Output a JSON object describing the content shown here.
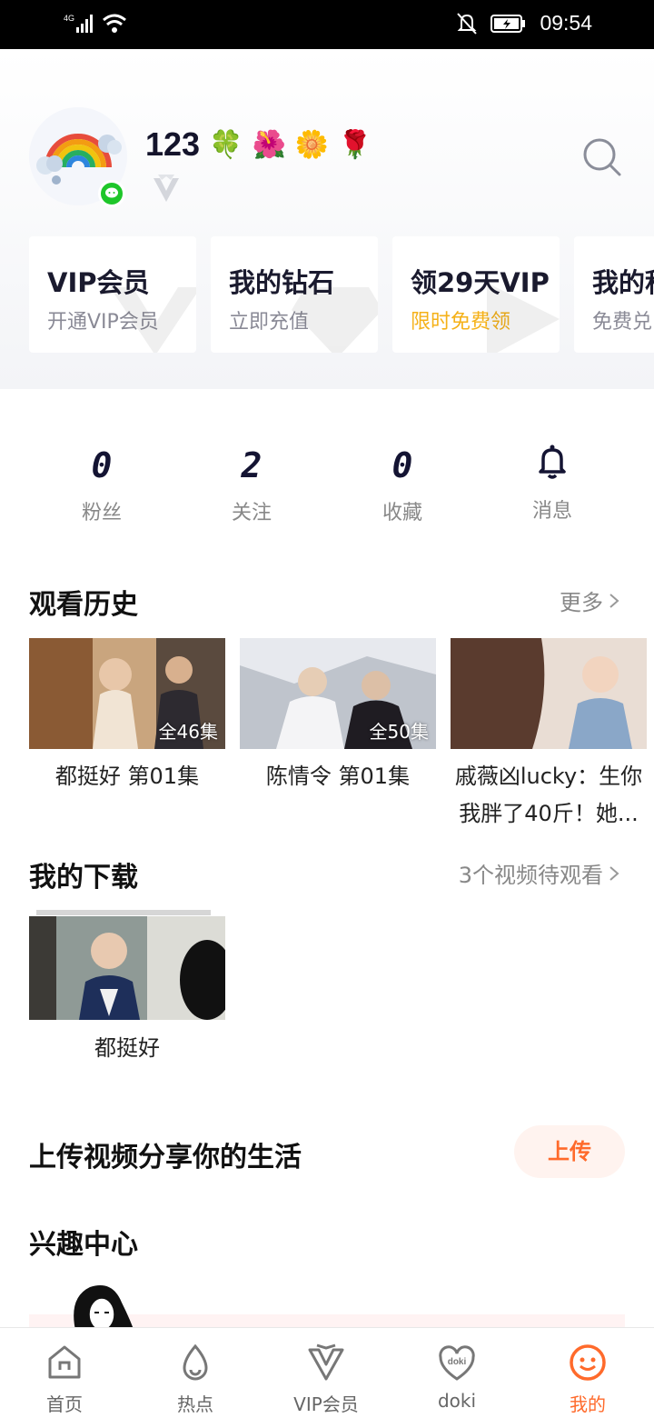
{
  "status_bar": {
    "network": "4G",
    "time": "09:54"
  },
  "profile": {
    "name": "123",
    "name_emojis": [
      "🍀",
      "🌺",
      "🌼",
      "🌹"
    ]
  },
  "benefit_cards": [
    {
      "title": "VIP会员",
      "subtitle": "开通VIP会员",
      "highlight": false
    },
    {
      "title": "我的钻石",
      "subtitle": "立即充值",
      "highlight": false
    },
    {
      "title": "领29天VIP",
      "subtitle": "限时免费领",
      "highlight": true
    },
    {
      "title": "我的积",
      "subtitle": "免费兑",
      "highlight": false
    }
  ],
  "stats": [
    {
      "value": "0",
      "label": "粉丝"
    },
    {
      "value": "2",
      "label": "关注"
    },
    {
      "value": "0",
      "label": "收藏"
    },
    {
      "label": "消息"
    }
  ],
  "history": {
    "title": "观看历史",
    "more": "更多",
    "items": [
      {
        "badge": "全46集",
        "title": "都挺好 第01集"
      },
      {
        "badge": "全50集",
        "title": "陈情令 第01集"
      },
      {
        "badge": "",
        "title_line1": "戚薇凶lucky：生你",
        "title_line2": "我胖了40斤！她..."
      }
    ]
  },
  "downloads": {
    "title": "我的下载",
    "pending": "3个视频待观看",
    "items": [
      {
        "title": "都挺好"
      }
    ]
  },
  "upload": {
    "title": "上传视频分享你的生活",
    "button": "上传"
  },
  "interest": {
    "title": "兴趣中心"
  },
  "tabbar": {
    "tabs": [
      {
        "label": "首页",
        "active": false
      },
      {
        "label": "热点",
        "active": false
      },
      {
        "label": "VIP会员",
        "active": false
      },
      {
        "label": "doki",
        "active": false
      },
      {
        "label": "我的",
        "active": true
      }
    ]
  },
  "colors": {
    "accent": "#ff6a2b",
    "highlight": "#f5b118",
    "wechat": "#1ec62a"
  }
}
